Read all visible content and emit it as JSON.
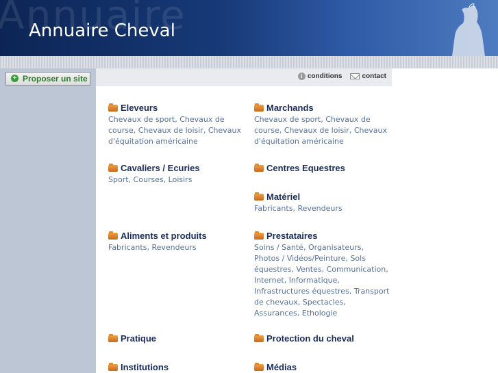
{
  "header": {
    "title": "Annuaire Cheval",
    "bg_word": "Annuaire"
  },
  "sidebar": {
    "propose_label": "Proposer un site"
  },
  "topbar": {
    "conditions": "conditions",
    "contact": "contact"
  },
  "categories": [
    {
      "title": "Eleveurs",
      "subs": [
        "Chevaux de sport",
        "Chevaux de course",
        "Chevaux de loisir",
        "Chevaux d'équitation américaine"
      ]
    },
    {
      "title": "Marchands",
      "subs": [
        "Chevaux de sport",
        "Chevaux de course",
        "Chevaux de loisir",
        "Chevaux d'équitation américaine"
      ]
    },
    {
      "title": "Cavaliers / Ecuries",
      "subs": [
        "Sport",
        "Courses",
        "Loisirs"
      ]
    },
    {
      "title": "Centres Equestres",
      "subs": []
    },
    {
      "title": "Matériel",
      "subs": [
        "Fabricants",
        "Revendeurs"
      ]
    },
    {
      "title": "Aliments et produits",
      "subs": [
        "Fabricants",
        "Revendeurs"
      ]
    },
    {
      "title": "Prestataires",
      "subs": [
        "Soins / Santé",
        "Organisateurs",
        "Photos / Vidéos/Peinture",
        "Sols équestres",
        "Ventes",
        "Communication",
        "Internet",
        "Informatique",
        "Infrastructures équestres",
        "Transport de chevaux",
        "Spectacles",
        "Assurances",
        "Ethologie"
      ]
    },
    {
      "title": "Pratique",
      "subs": []
    },
    {
      "title": "Protection du cheval",
      "subs": []
    },
    {
      "title": "Institutions",
      "subs": []
    },
    {
      "title": "Médias",
      "subs": []
    }
  ]
}
